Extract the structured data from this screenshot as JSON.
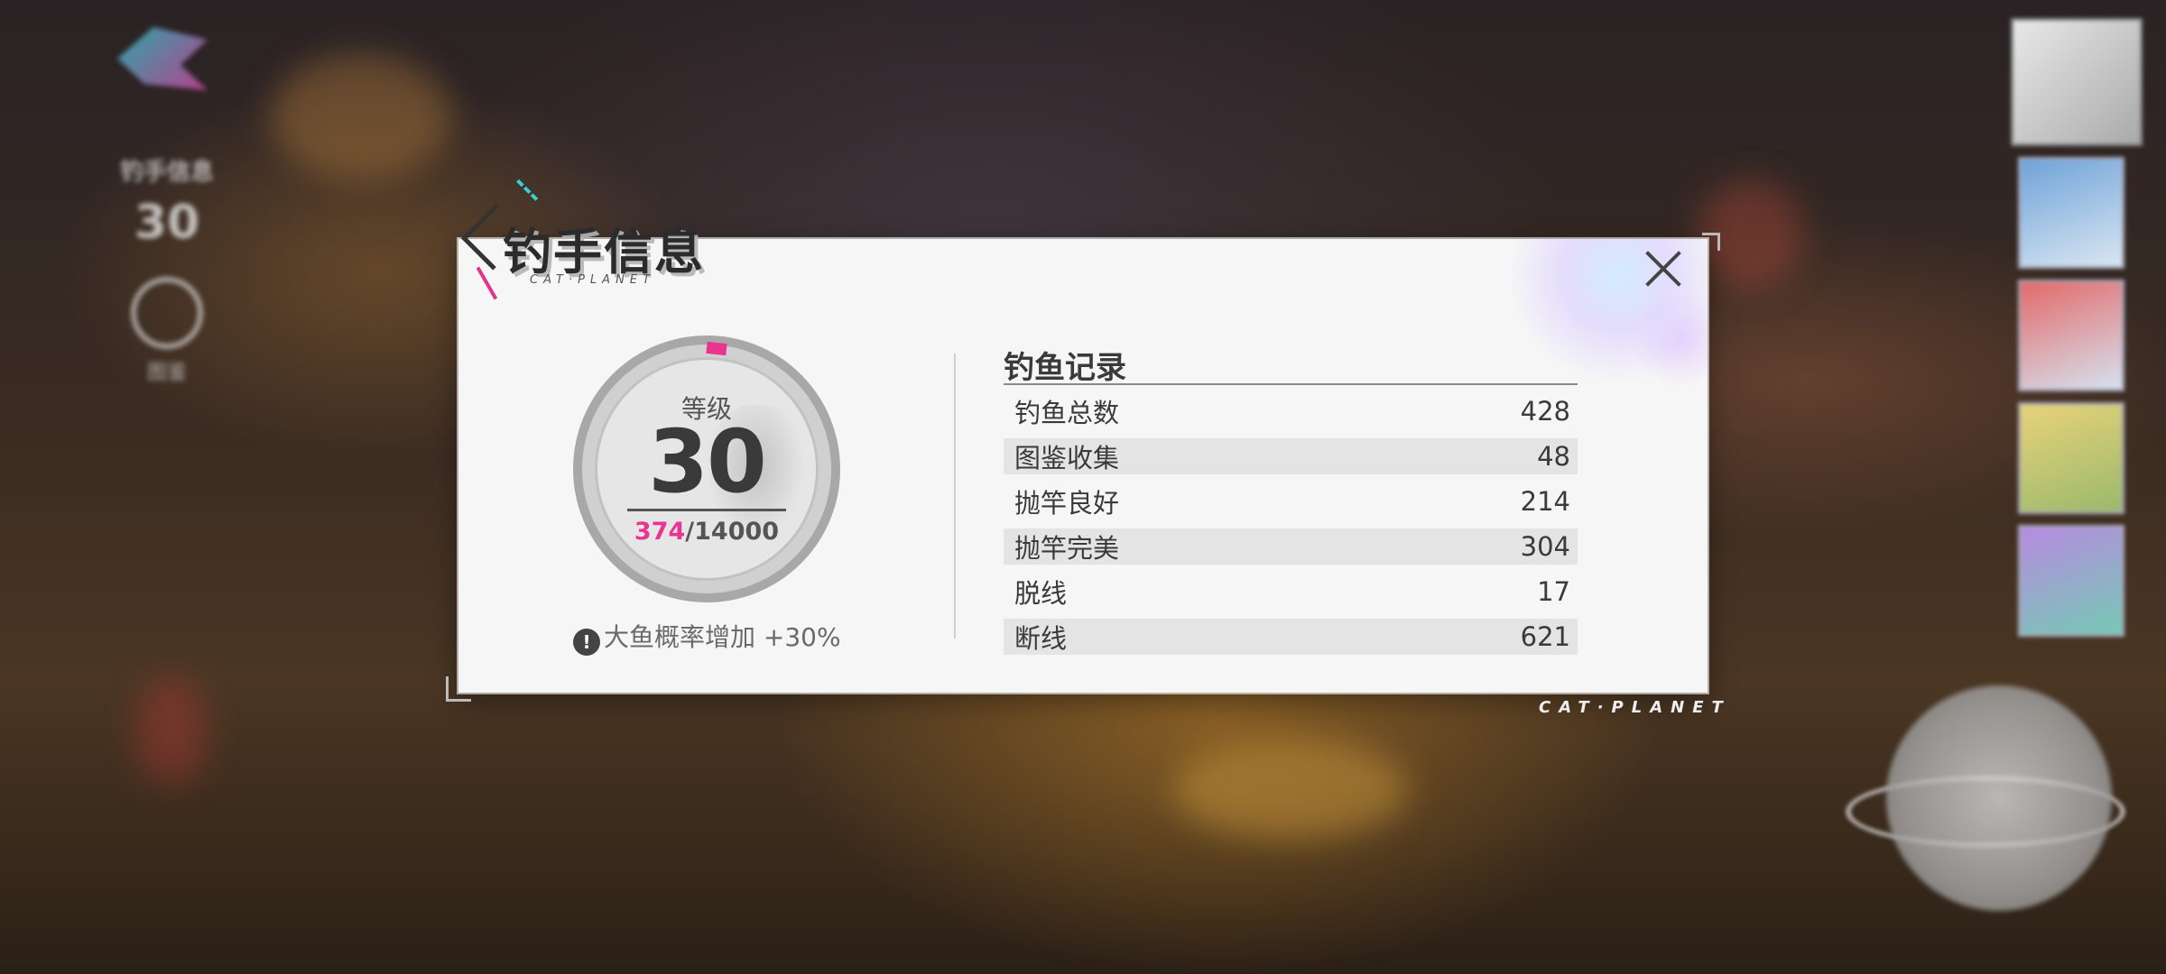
{
  "hud": {
    "level_label": "钓手信息",
    "level_value": "30",
    "globe_label": "图鉴"
  },
  "dialog": {
    "title": "钓手信息",
    "subtitle": "CAT·PLANET",
    "brand_bottom": "CAT·PLANET"
  },
  "level": {
    "label": "等级",
    "value": "30",
    "exp_current": "374",
    "exp_total": "/14000",
    "progress": 0.0267
  },
  "bonus": {
    "icon": "!",
    "text": "大鱼概率增加 +30%"
  },
  "records": {
    "title": "钓鱼记录",
    "rows": [
      {
        "label": "钓鱼总数",
        "value": "428"
      },
      {
        "label": "图鉴收集",
        "value": "48"
      },
      {
        "label": "抛竿良好",
        "value": "214"
      },
      {
        "label": "抛竿完美",
        "value": "304"
      },
      {
        "label": "脱线",
        "value": "17"
      },
      {
        "label": "断线",
        "value": "621"
      }
    ]
  },
  "colors": {
    "accent_pink": "#e8358f",
    "accent_cyan": "#35d2d4",
    "dialog_bg": "#f6f6f6"
  }
}
